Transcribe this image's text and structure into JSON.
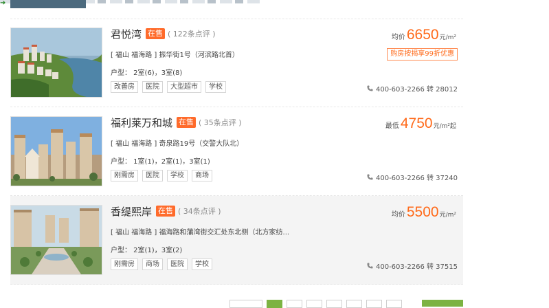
{
  "listings": [
    {
      "title": "君悦湾",
      "badge": "在售",
      "reviews": "( 122条点评 )",
      "address": "[ 福山 福海路 ] 振华街1号（河滨路北首）",
      "rooms": "户型： 2室(6)，3室(8)",
      "tags": [
        "改善房",
        "医院",
        "大型超市",
        "学校"
      ],
      "price_prefix": "均价",
      "price": "6650",
      "price_unit": "元/m²",
      "promo": "购房按揭享99折优惠",
      "phone": "400-603-2266 转 28012"
    },
    {
      "title": "福利莱万和城",
      "badge": "在售",
      "reviews": "( 35条点评 )",
      "address": "[ 福山 福海路 ] 奇泉路19号（交警大队北）",
      "rooms": "户型： 1室(1)，2室(1)，3室(1)",
      "tags": [
        "刚需房",
        "医院",
        "学校",
        "商场"
      ],
      "price_prefix": "最低",
      "price": "4750",
      "price_unit": "元/m²起",
      "promo": "",
      "phone": "400-603-2266 转 37240"
    },
    {
      "title": "香缇熙岸",
      "badge": "在售",
      "reviews": "( 34条点评 )",
      "address": "[ 福山 福海路 ] 福海路和蒲湾街交汇处东北侧（北方家纺...",
      "rooms": "户型： 2室(1)，3室(2)",
      "tags": [
        "刚需房",
        "商场",
        "医院",
        "学校"
      ],
      "price_prefix": "均价",
      "price": "5500",
      "price_unit": "元/m²",
      "promo": "",
      "phone": "400-603-2266 转 37515"
    }
  ],
  "colors": {
    "accent": "#ff6a1a",
    "badge": "#ff6b2b",
    "pager_active": "#7cb342"
  },
  "icons": {
    "phone": "phone-icon"
  }
}
